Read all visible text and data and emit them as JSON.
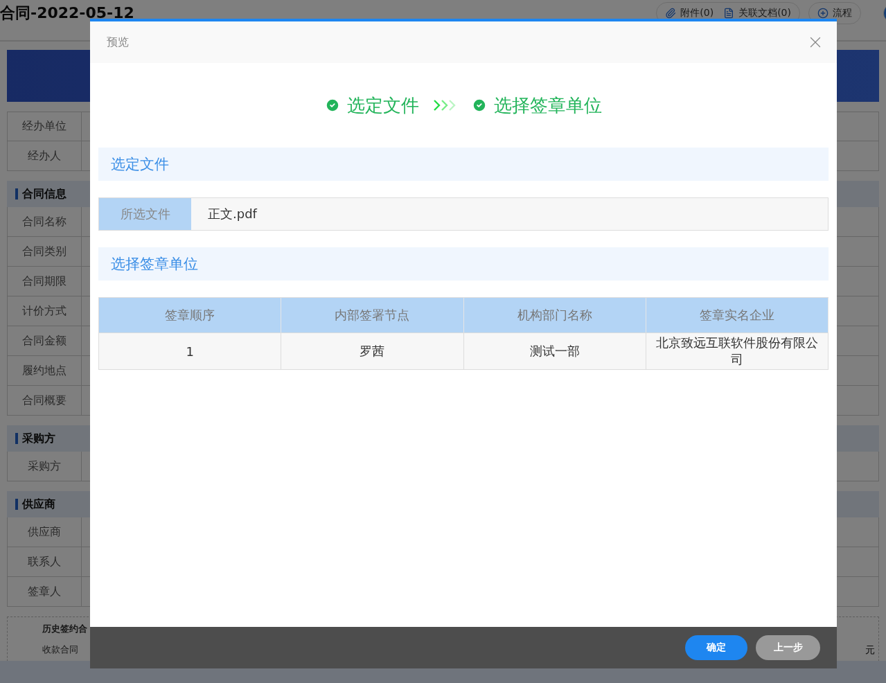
{
  "page": {
    "title": "合同-2022-05-12",
    "actions": [
      {
        "kind": "attach",
        "label": "附件(0)"
      },
      {
        "kind": "doc",
        "label": "关联文档(0)"
      },
      {
        "kind": "flow",
        "label": "流程"
      }
    ],
    "sections": [
      {
        "rows": [
          "经办单位",
          "经办人"
        ]
      },
      {
        "heading": "合同信息",
        "rows": [
          "合同名称",
          "合同类别",
          "合同期限",
          "计价方式",
          "合同金额",
          "履约地点",
          "合同概要"
        ]
      },
      {
        "heading": "采购方",
        "rows": [
          "采购方"
        ]
      },
      {
        "heading": "供应商",
        "rows": [
          "供应商",
          "联系人",
          "签章人"
        ]
      }
    ],
    "history": {
      "title": "历史签约合",
      "row_label": "收款合同",
      "unit": "元"
    }
  },
  "dialog": {
    "title": "预览",
    "steps": [
      {
        "label": "选定文件",
        "done": true
      },
      {
        "label": "选择签章单位",
        "done": true
      }
    ],
    "file_section": {
      "heading": "选定文件",
      "label": "所选文件",
      "value": "正文.pdf"
    },
    "unit_section": {
      "heading": "选择签章单位",
      "columns": [
        "签章顺序",
        "内部签署节点",
        "机构部门名称",
        "签章实名企业"
      ],
      "rows": [
        [
          "1",
          "罗茜",
          "测试一部",
          "北京致远互联软件股份有限公司"
        ]
      ]
    },
    "buttons": [
      {
        "label": "确定",
        "kind": "primary"
      },
      {
        "label": "上一步",
        "kind": "secondary"
      }
    ]
  }
}
